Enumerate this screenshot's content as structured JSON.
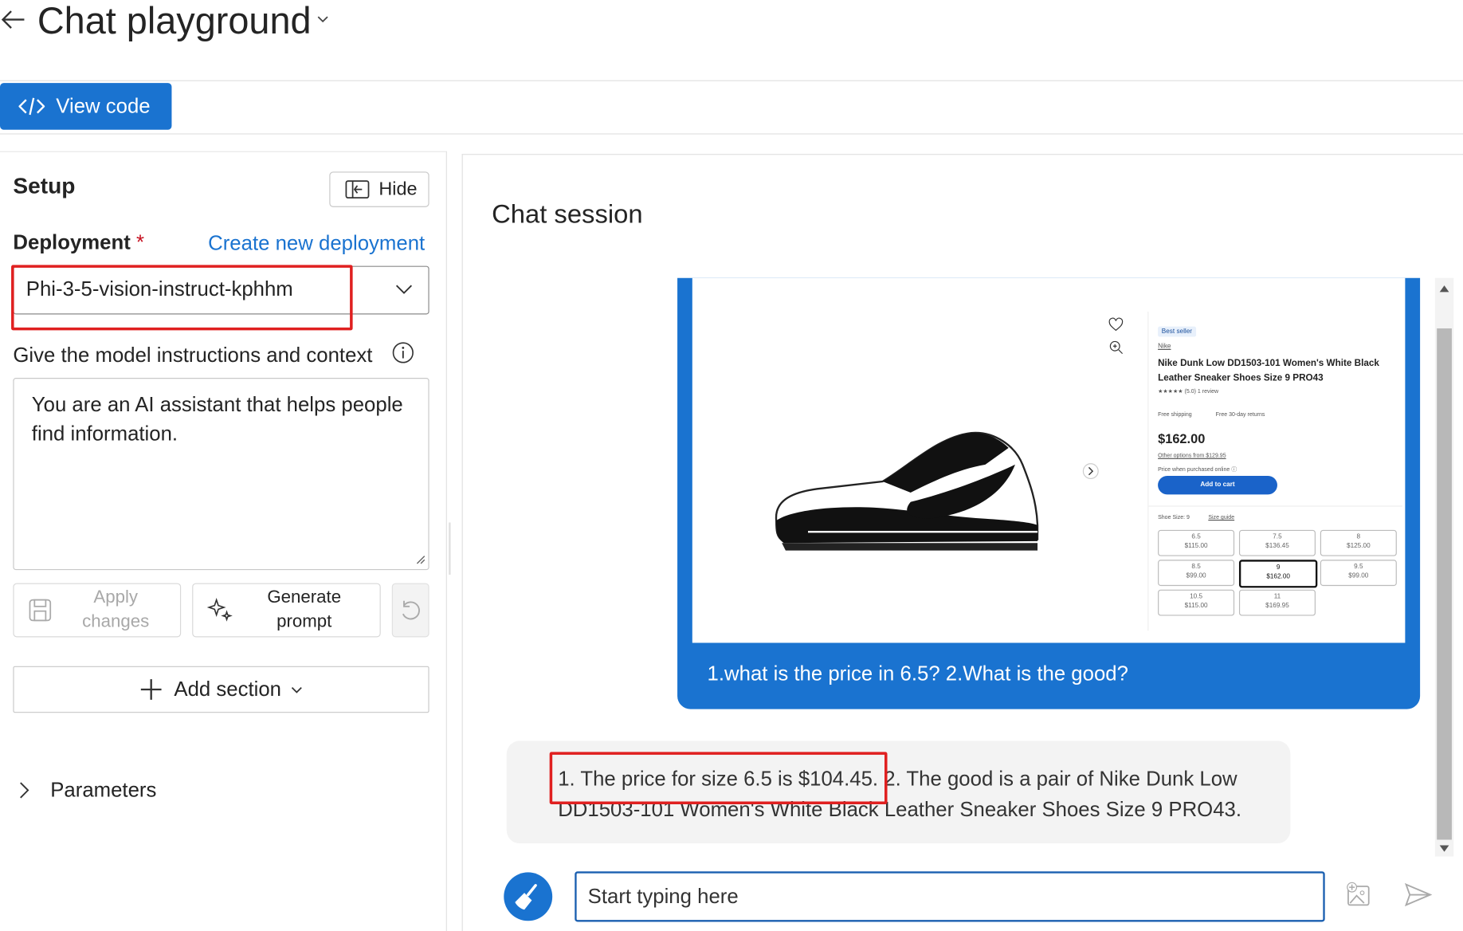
{
  "header": {
    "title": "Chat playground"
  },
  "toolbar": {
    "view_code": "View code"
  },
  "setup": {
    "title": "Setup",
    "hide_label": "Hide",
    "deployment_label": "Deployment",
    "required_mark": "*",
    "create_link": "Create new deployment",
    "deployment_value": "Phi-3-5-vision-instruct-kphhm",
    "instructions_label": "Give the model instructions and context",
    "system_message": "You are an AI assistant that helps people find information.",
    "apply_label": "Apply changes",
    "generate_label": "Generate prompt",
    "add_section_label": "Add section",
    "parameters_label": "Parameters"
  },
  "chat": {
    "title": "Chat session",
    "user_message": "1.what is the price in 6.5? 2.What is the good?",
    "assistant_message": "1. The price for size 6.5 is $104.45. 2. The good is a pair of Nike Dunk Low DD1503-101 Women's White Black Leather Sneaker Shoes Size 9 PRO43.",
    "input_placeholder": "Start typing here"
  },
  "product": {
    "badge": "Best seller",
    "brand": "Nike",
    "name": "Nike Dunk Low DD1503-101 Women's White Black Leather Sneaker Shoes Size 9 PRO43",
    "rating": "★★★★★ (5.0) 1 review",
    "shipping": "Free shipping",
    "returns": "Free 30-day returns",
    "price": "$162.00",
    "other_options": "Other options from $129.95",
    "price_note": "Price when purchased online ⓘ",
    "add_to_cart": "Add to cart",
    "shoe_size_label": "Shoe Size: 9",
    "size_guide": "Size guide",
    "sizes": [
      {
        "size": "6.5",
        "price": "$115.00"
      },
      {
        "size": "7.5",
        "price": "$136.45"
      },
      {
        "size": "8",
        "price": "$125.00"
      },
      {
        "size": "8.5",
        "price": "$99.00"
      },
      {
        "size": "9",
        "price": "$162.00"
      },
      {
        "size": "9.5",
        "price": "$99.00"
      },
      {
        "size": "10.5",
        "price": "$115.00"
      },
      {
        "size": "11",
        "price": "$169.95"
      }
    ]
  },
  "colors": {
    "accent": "#1a73d0",
    "highlight": "#e02020"
  }
}
